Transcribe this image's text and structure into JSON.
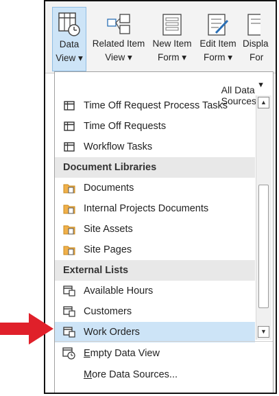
{
  "ribbon": {
    "buttons": [
      {
        "line1": "Data",
        "line2": "View",
        "icon": "data-view-icon"
      },
      {
        "line1": "Related Item",
        "line2": "View",
        "icon": "related-item-view-icon"
      },
      {
        "line1": "New Item",
        "line2": "Form",
        "icon": "new-item-form-icon"
      },
      {
        "line1": "Edit Item",
        "line2": "Form",
        "icon": "edit-item-form-icon"
      },
      {
        "line1": "Displa",
        "line2": "For",
        "icon": "display-form-icon"
      }
    ]
  },
  "menu": {
    "filter_label": "All Data Sources",
    "lists": [
      {
        "label": "Time Off Request Process Tasks",
        "icon": "list-icon"
      },
      {
        "label": "Time Off Requests",
        "icon": "list-icon"
      },
      {
        "label": "Workflow Tasks",
        "icon": "list-icon"
      }
    ],
    "doc_header": "Document Libraries",
    "libraries": [
      {
        "label": "Documents",
        "icon": "library-icon"
      },
      {
        "label": "Internal Projects Documents",
        "icon": "library-icon"
      },
      {
        "label": "Site Assets",
        "icon": "library-icon"
      },
      {
        "label": "Site Pages",
        "icon": "library-icon"
      }
    ],
    "ext_header": "External Lists",
    "external": [
      {
        "label": "Available Hours",
        "icon": "external-list-icon"
      },
      {
        "label": "Customers",
        "icon": "external-list-icon"
      },
      {
        "label": "Work Orders",
        "icon": "external-list-icon",
        "selected": true
      }
    ],
    "empty_first": "E",
    "empty_rest": "mpty Data View",
    "more_first": "M",
    "more_rest": "ore Data Sources..."
  },
  "colors": {
    "selection": "#cde4f7",
    "arrow": "#e0202a",
    "group_bg": "#e8e8e8"
  }
}
